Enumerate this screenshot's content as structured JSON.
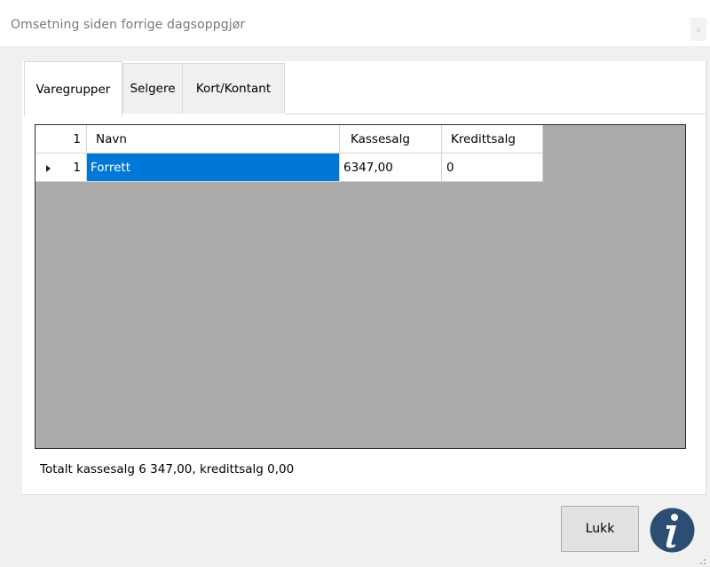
{
  "window": {
    "title": "Omsetning siden forrige dagsoppgjør",
    "close_symbol": "x"
  },
  "tabs": [
    {
      "label": "Varegrupper",
      "active": true
    },
    {
      "label": "Selgere",
      "active": false
    },
    {
      "label": "Kort/Kontant",
      "active": false
    }
  ],
  "grid": {
    "row_header_label": "1",
    "columns": [
      "Navn",
      "Kassesalg",
      "Kredittsalg"
    ],
    "rows": [
      {
        "row_number": "1",
        "cells": [
          "Forrett",
          "6347,00",
          "0"
        ],
        "selected": true
      }
    ]
  },
  "summary": {
    "text": "Totalt kassesalg 6 347,00, kredittsalg 0,00"
  },
  "buttons": {
    "close_label": "Lukk"
  },
  "icons": {
    "info": "info-icon",
    "row_indicator": "row-arrow-icon",
    "resize": "resize-grip-icon"
  },
  "colors": {
    "selection": "#0078d7",
    "info_icon": "#2d4e73",
    "grid_background": "#ababab"
  }
}
